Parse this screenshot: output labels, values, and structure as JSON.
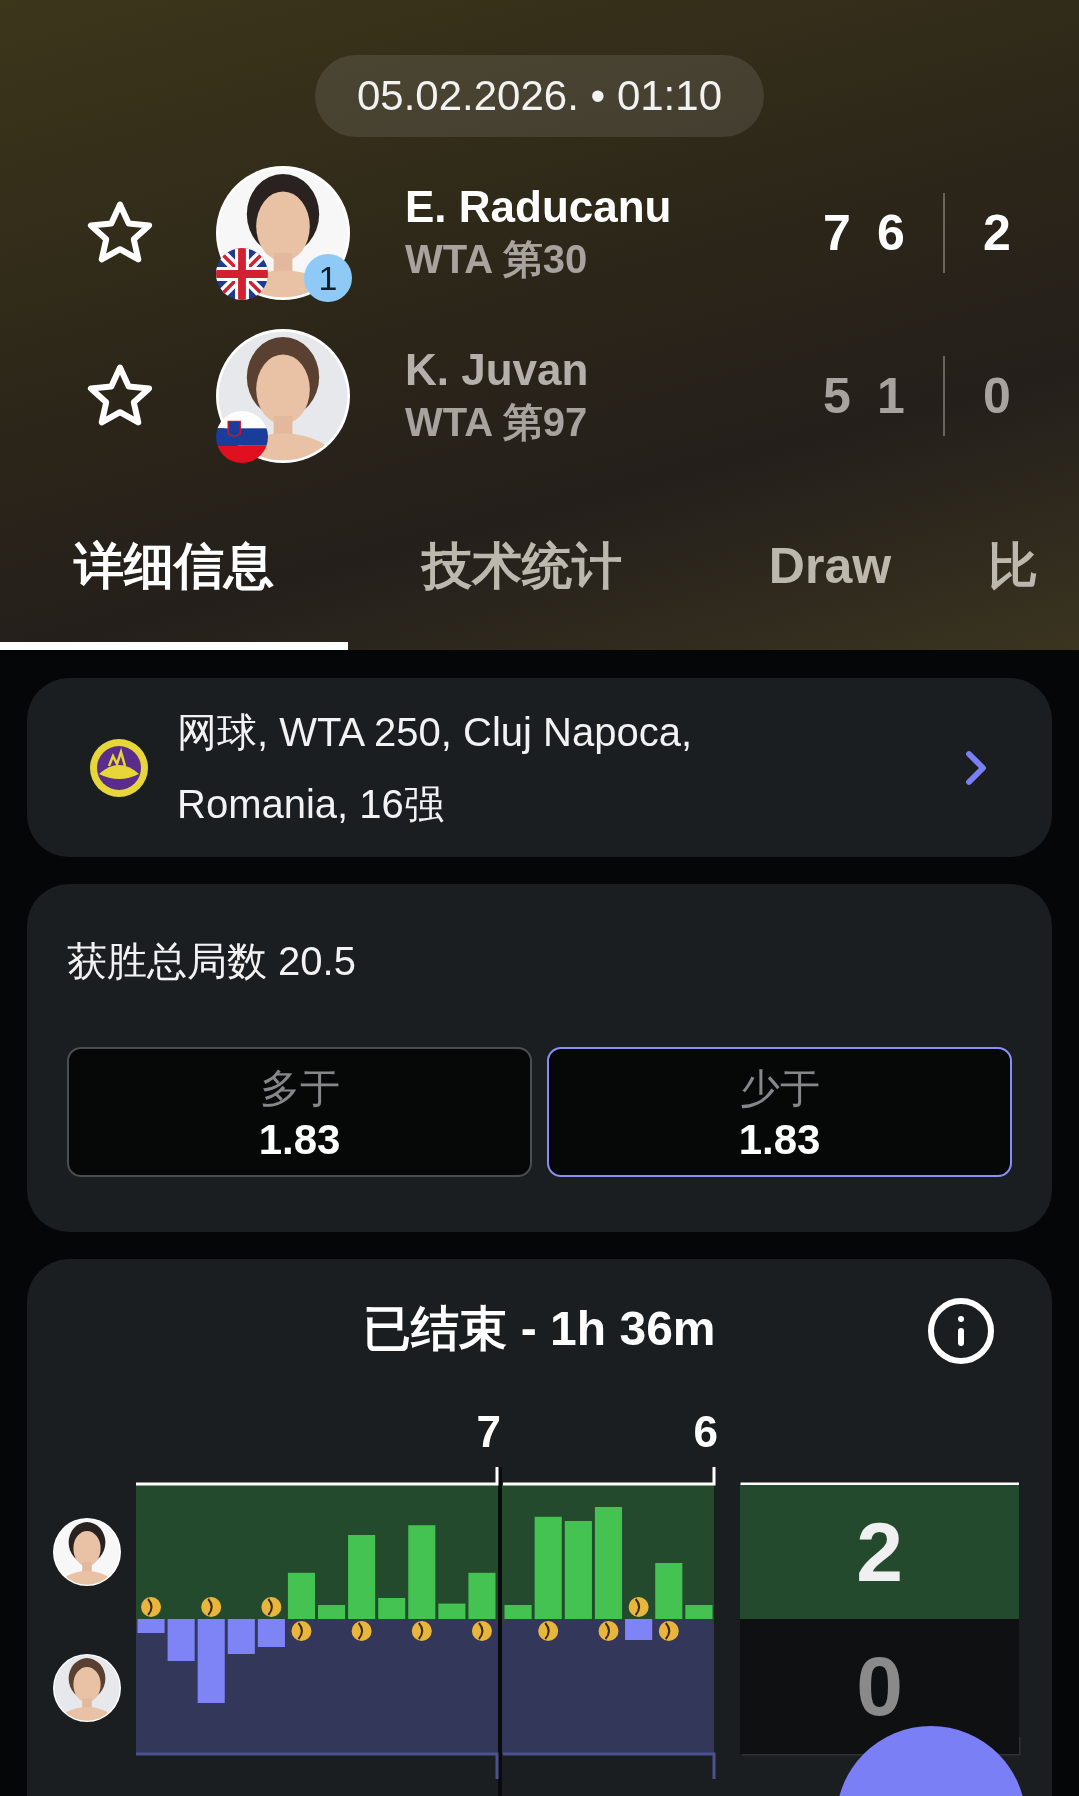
{
  "match": {
    "datetime": "05.02.2026. • 01:10"
  },
  "players": [
    {
      "name": "E. Raducanu",
      "ranking": "WTA 第30",
      "seed": "1",
      "favorite": false,
      "winner": true,
      "flag": {
        "kind": "gb"
      },
      "games": [
        "7",
        "6"
      ],
      "sets": "2"
    },
    {
      "name": "K. Juvan",
      "ranking": "WTA 第97",
      "favorite": false,
      "winner": false,
      "flag": {
        "kind": "si"
      },
      "games": [
        "5",
        "1"
      ],
      "sets": "0"
    }
  ],
  "tabs": [
    {
      "label": "详细信息",
      "selected": true
    },
    {
      "label": "技术统计",
      "selected": false
    },
    {
      "label": "Draw",
      "selected": false
    },
    {
      "label": "比",
      "selected": false
    }
  ],
  "tournament": {
    "text": "网球, WTA 250, Cluj Napoca, Romania, 16强"
  },
  "odds": {
    "title": "获胜总局数 20.5",
    "options": [
      {
        "label": "多于",
        "value": "1.83",
        "selected": false
      },
      {
        "label": "少于",
        "value": "1.83",
        "selected": true
      }
    ]
  },
  "summary": {
    "status": "已结束 - 1h 36m",
    "set_labels": [
      "7",
      "6"
    ],
    "scores": [
      {
        "value": "2",
        "winner": true
      },
      {
        "value": "0",
        "winner": false
      }
    ]
  }
}
